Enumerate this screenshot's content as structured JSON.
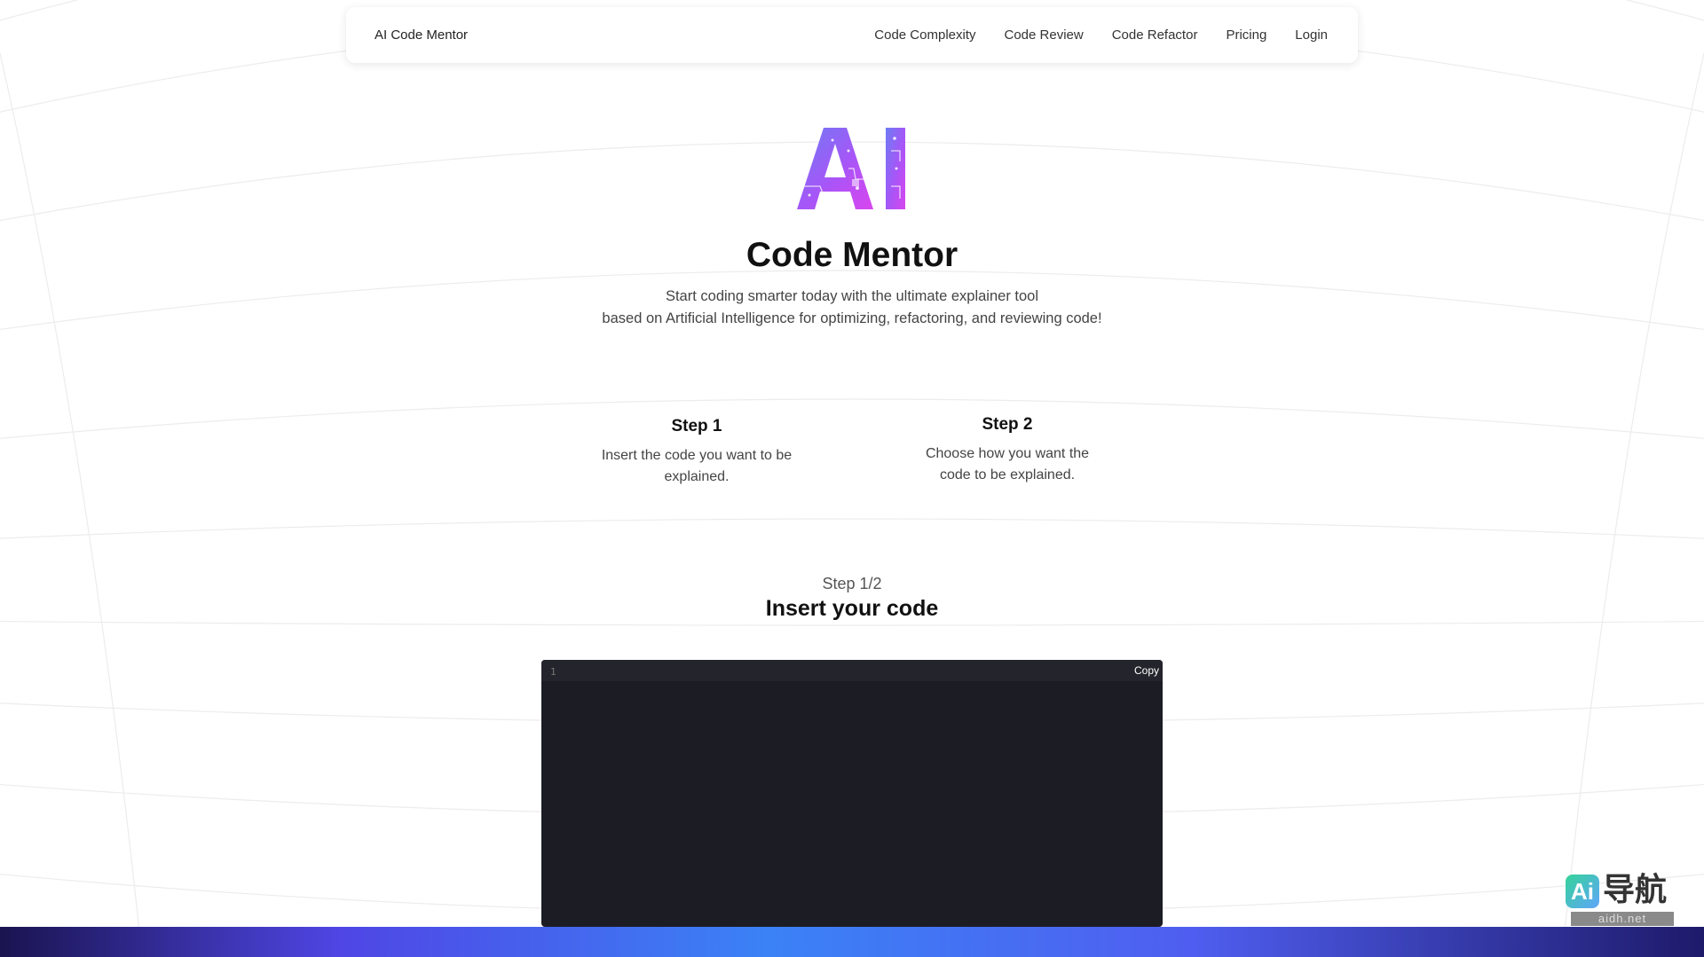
{
  "navbar": {
    "brand": "AI Code Mentor",
    "links": [
      "Code Complexity",
      "Code Review",
      "Code Refactor",
      "Pricing",
      "Login"
    ]
  },
  "hero": {
    "logo_text": "AI",
    "title": "Code Mentor",
    "subtitle_line1": "Start coding smarter today with the ultimate explainer tool",
    "subtitle_line2": "based on Artificial Intelligence for optimizing, refactoring, and reviewing code!"
  },
  "steps": [
    {
      "title": "Step 1",
      "desc_line1": "Insert the code you want to be",
      "desc_line2": "explained."
    },
    {
      "title": "Step 2",
      "desc_line1": "Choose how you want the",
      "desc_line2": "code to be explained."
    }
  ],
  "insert": {
    "progress": "Step 1/2",
    "title": "Insert your code"
  },
  "editor": {
    "line_number": "1",
    "copy_label": "Copy",
    "background": "#1c1d24"
  },
  "watermark": {
    "badge": "Ai",
    "text": "导航",
    "url": "aidh.net"
  },
  "colors": {
    "logo_gradient_start": "#7c6cf0",
    "logo_gradient_end": "#c04fd6",
    "bottom_bar": "#4f5ef0"
  }
}
